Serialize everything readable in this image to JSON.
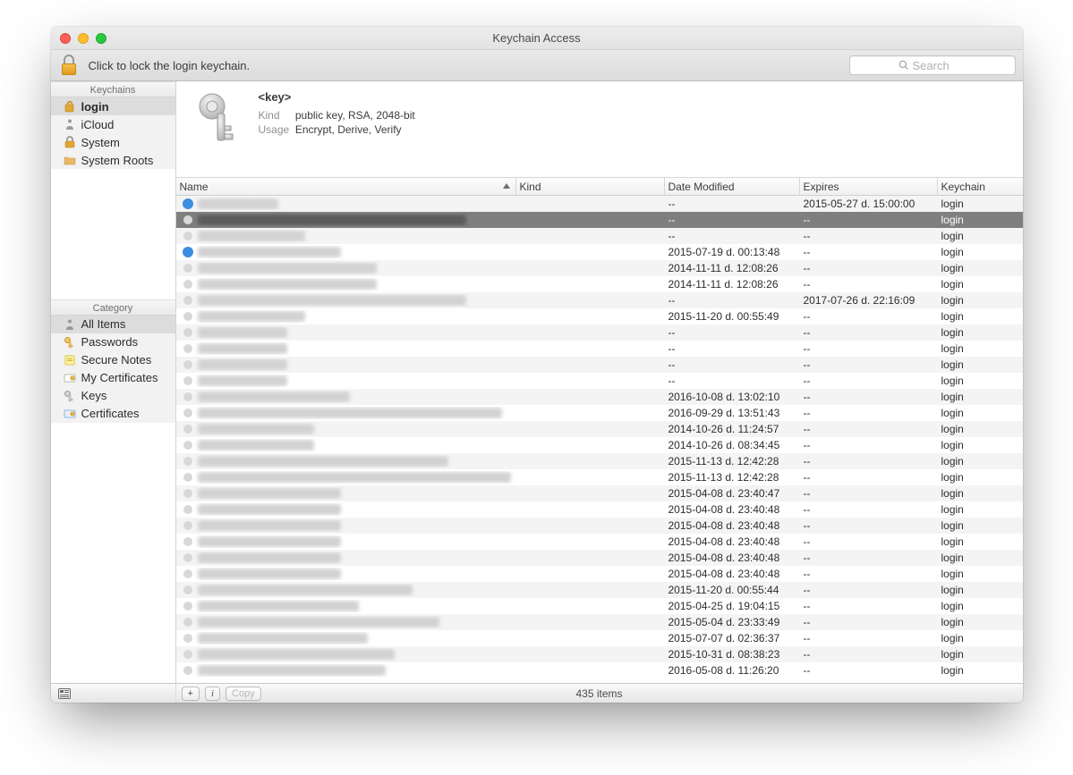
{
  "window": {
    "title": "Keychain Access"
  },
  "toolbar": {
    "lock_hint": "Click to lock the login keychain.",
    "search_placeholder": "Search"
  },
  "sidebar": {
    "keychains_header": "Keychains",
    "category_header": "Category",
    "keychains": [
      {
        "label": "login",
        "icon": "lock-open",
        "selected": true
      },
      {
        "label": "iCloud",
        "icon": "figure",
        "selected": false
      },
      {
        "label": "System",
        "icon": "lock",
        "selected": false
      },
      {
        "label": "System Roots",
        "icon": "folder",
        "selected": false
      }
    ],
    "categories": [
      {
        "label": "All Items",
        "icon": "figure",
        "selected": true
      },
      {
        "label": "Passwords",
        "icon": "key-gold",
        "selected": false
      },
      {
        "label": "Secure Notes",
        "icon": "note",
        "selected": false
      },
      {
        "label": "My Certificates",
        "icon": "cert",
        "selected": false
      },
      {
        "label": "Keys",
        "icon": "key",
        "selected": false
      },
      {
        "label": "Certificates",
        "icon": "cert-blue",
        "selected": false
      }
    ]
  },
  "detail": {
    "title": "<key>",
    "kind_label": "Kind",
    "kind_value": "public key, RSA, 2048-bit",
    "usage_label": "Usage",
    "usage_value": "Encrypt, Derive, Verify"
  },
  "table": {
    "headers": {
      "name": "Name",
      "kind": "Kind",
      "date": "Date Modified",
      "expires": "Expires",
      "keychain": "Keychain"
    },
    "rows": [
      {
        "selected": false,
        "name_blur_w": 90,
        "kind_blur_w": 60,
        "date": "--",
        "expires": "2015-05-27 d. 15:00:00",
        "keychain": "login",
        "icon": "blue"
      },
      {
        "selected": true,
        "name_blur_w": 300,
        "kind_blur_w": 100,
        "date": "--",
        "expires": "--",
        "keychain": "login",
        "icon": "grey"
      },
      {
        "selected": false,
        "name_blur_w": 120,
        "kind_blur_w": 60,
        "date": "--",
        "expires": "--",
        "keychain": "login",
        "icon": "grey"
      },
      {
        "selected": false,
        "name_blur_w": 160,
        "kind_blur_w": 110,
        "date": "2015-07-19 d. 00:13:48",
        "expires": "--",
        "keychain": "login",
        "icon": "blue"
      },
      {
        "selected": false,
        "name_blur_w": 200,
        "kind_blur_w": 120,
        "date": "2014-11-11 d. 12:08:26",
        "expires": "--",
        "keychain": "login",
        "icon": "grey"
      },
      {
        "selected": false,
        "name_blur_w": 200,
        "kind_blur_w": 120,
        "date": "2014-11-11 d. 12:08:26",
        "expires": "--",
        "keychain": "login",
        "icon": "grey"
      },
      {
        "selected": false,
        "name_blur_w": 300,
        "kind_blur_w": 80,
        "date": "--",
        "expires": "2017-07-26 d. 22:16:09",
        "keychain": "login",
        "icon": "grey"
      },
      {
        "selected": false,
        "name_blur_w": 120,
        "kind_blur_w": 110,
        "date": "2015-11-20 d. 00:55:49",
        "expires": "--",
        "keychain": "login",
        "icon": "grey"
      },
      {
        "selected": false,
        "name_blur_w": 100,
        "kind_blur_w": 110,
        "date": "--",
        "expires": "--",
        "keychain": "login",
        "icon": "grey"
      },
      {
        "selected": false,
        "name_blur_w": 100,
        "kind_blur_w": 110,
        "date": "--",
        "expires": "--",
        "keychain": "login",
        "icon": "grey"
      },
      {
        "selected": false,
        "name_blur_w": 100,
        "kind_blur_w": 110,
        "date": "--",
        "expires": "--",
        "keychain": "login",
        "icon": "grey"
      },
      {
        "selected": false,
        "name_blur_w": 100,
        "kind_blur_w": 110,
        "date": "--",
        "expires": "--",
        "keychain": "login",
        "icon": "grey"
      },
      {
        "selected": false,
        "name_blur_w": 170,
        "kind_blur_w": 110,
        "date": "2016-10-08 d. 13:02:10",
        "expires": "--",
        "keychain": "login",
        "icon": "grey"
      },
      {
        "selected": false,
        "name_blur_w": 340,
        "kind_blur_w": 110,
        "date": "2016-09-29 d. 13:51:43",
        "expires": "--",
        "keychain": "login",
        "icon": "grey"
      },
      {
        "selected": false,
        "name_blur_w": 130,
        "kind_blur_w": 110,
        "date": "2014-10-26 d. 11:24:57",
        "expires": "--",
        "keychain": "login",
        "icon": "grey"
      },
      {
        "selected": false,
        "name_blur_w": 130,
        "kind_blur_w": 110,
        "date": "2014-10-26 d. 08:34:45",
        "expires": "--",
        "keychain": "login",
        "icon": "grey"
      },
      {
        "selected": false,
        "name_blur_w": 280,
        "kind_blur_w": 110,
        "date": "2015-11-13 d. 12:42:28",
        "expires": "--",
        "keychain": "login",
        "icon": "grey"
      },
      {
        "selected": false,
        "name_blur_w": 350,
        "kind_blur_w": 110,
        "date": "2015-11-13 d. 12:42:28",
        "expires": "--",
        "keychain": "login",
        "icon": "grey"
      },
      {
        "selected": false,
        "name_blur_w": 160,
        "kind_blur_w": 110,
        "date": "2015-04-08 d. 23:40:47",
        "expires": "--",
        "keychain": "login",
        "icon": "grey"
      },
      {
        "selected": false,
        "name_blur_w": 160,
        "kind_blur_w": 110,
        "date": "2015-04-08 d. 23:40:48",
        "expires": "--",
        "keychain": "login",
        "icon": "grey"
      },
      {
        "selected": false,
        "name_blur_w": 160,
        "kind_blur_w": 110,
        "date": "2015-04-08 d. 23:40:48",
        "expires": "--",
        "keychain": "login",
        "icon": "grey"
      },
      {
        "selected": false,
        "name_blur_w": 160,
        "kind_blur_w": 110,
        "date": "2015-04-08 d. 23:40:48",
        "expires": "--",
        "keychain": "login",
        "icon": "grey"
      },
      {
        "selected": false,
        "name_blur_w": 160,
        "kind_blur_w": 110,
        "date": "2015-04-08 d. 23:40:48",
        "expires": "--",
        "keychain": "login",
        "icon": "grey"
      },
      {
        "selected": false,
        "name_blur_w": 160,
        "kind_blur_w": 110,
        "date": "2015-04-08 d. 23:40:48",
        "expires": "--",
        "keychain": "login",
        "icon": "grey"
      },
      {
        "selected": false,
        "name_blur_w": 240,
        "kind_blur_w": 110,
        "date": "2015-11-20 d. 00:55:44",
        "expires": "--",
        "keychain": "login",
        "icon": "grey"
      },
      {
        "selected": false,
        "name_blur_w": 180,
        "kind_blur_w": 110,
        "date": "2015-04-25 d. 19:04:15",
        "expires": "--",
        "keychain": "login",
        "icon": "grey"
      },
      {
        "selected": false,
        "name_blur_w": 270,
        "kind_blur_w": 110,
        "date": "2015-05-04 d. 23:33:49",
        "expires": "--",
        "keychain": "login",
        "icon": "grey"
      },
      {
        "selected": false,
        "name_blur_w": 190,
        "kind_blur_w": 110,
        "date": "2015-07-07 d. 02:36:37",
        "expires": "--",
        "keychain": "login",
        "icon": "grey"
      },
      {
        "selected": false,
        "name_blur_w": 220,
        "kind_blur_w": 110,
        "date": "2015-10-31 d. 08:38:23",
        "expires": "--",
        "keychain": "login",
        "icon": "grey"
      },
      {
        "selected": false,
        "name_blur_w": 210,
        "kind_blur_w": 110,
        "date": "2016-05-08 d. 11:26:20",
        "expires": "--",
        "keychain": "login",
        "icon": "grey"
      }
    ]
  },
  "statusbar": {
    "count_text": "435 items",
    "copy_label": "Copy",
    "plus_label": "+",
    "info_label": "i"
  }
}
